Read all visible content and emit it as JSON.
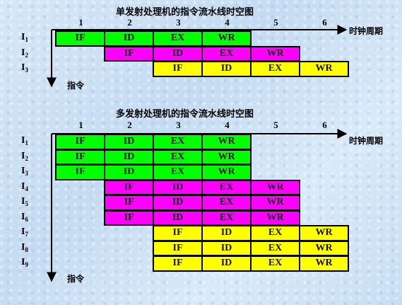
{
  "colors": {
    "stage_colors": [
      "#00ff00",
      "#ff00ff",
      "#ffff00"
    ]
  },
  "diagram1": {
    "title": "单发射处理机的指令流水线时空图",
    "x_axis_label": "时钟周期",
    "y_axis_label": "指令",
    "clock_labels": [
      "1",
      "2",
      "3",
      "4",
      "5",
      "6"
    ],
    "instructions": [
      {
        "label": "I",
        "sub": "1",
        "start": 0,
        "group": 0,
        "stages": [
          "IF",
          "ID",
          "EX",
          "WR"
        ]
      },
      {
        "label": "I",
        "sub": "2",
        "start": 1,
        "group": 1,
        "stages": [
          "IF",
          "ID",
          "EX",
          "WR"
        ]
      },
      {
        "label": "I",
        "sub": "3",
        "start": 2,
        "group": 2,
        "stages": [
          "IF",
          "ID",
          "EX",
          "WR"
        ]
      }
    ]
  },
  "diagram2": {
    "title": "多发射处理机的指令流水线时空图",
    "x_axis_label": "时钟周期",
    "y_axis_label": "指令",
    "clock_labels": [
      "1",
      "2",
      "3",
      "4",
      "5",
      "6"
    ],
    "instructions": [
      {
        "label": "I",
        "sub": "1",
        "start": 0,
        "group": 0,
        "stages": [
          "IF",
          "ID",
          "EX",
          "WR"
        ]
      },
      {
        "label": "I",
        "sub": "2",
        "start": 0,
        "group": 0,
        "stages": [
          "IF",
          "ID",
          "EX",
          "WR"
        ]
      },
      {
        "label": "I",
        "sub": "3",
        "start": 0,
        "group": 0,
        "stages": [
          "IF",
          "ID",
          "EX",
          "WR"
        ]
      },
      {
        "label": "I",
        "sub": "4",
        "start": 1,
        "group": 1,
        "stages": [
          "IF",
          "ID",
          "EX",
          "WR"
        ]
      },
      {
        "label": "I",
        "sub": "5",
        "start": 1,
        "group": 1,
        "stages": [
          "IF",
          "ID",
          "EX",
          "WR"
        ]
      },
      {
        "label": "I",
        "sub": "6",
        "start": 1,
        "group": 1,
        "stages": [
          "IF",
          "ID",
          "EX",
          "WR"
        ]
      },
      {
        "label": "I",
        "sub": "7",
        "start": 2,
        "group": 2,
        "stages": [
          "IF",
          "ID",
          "EX",
          "WR"
        ]
      },
      {
        "label": "I",
        "sub": "8",
        "start": 2,
        "group": 2,
        "stages": [
          "IF",
          "ID",
          "EX",
          "WR"
        ]
      },
      {
        "label": "I",
        "sub": "9",
        "start": 2,
        "group": 2,
        "stages": [
          "IF",
          "ID",
          "EX",
          "WR"
        ]
      }
    ]
  }
}
